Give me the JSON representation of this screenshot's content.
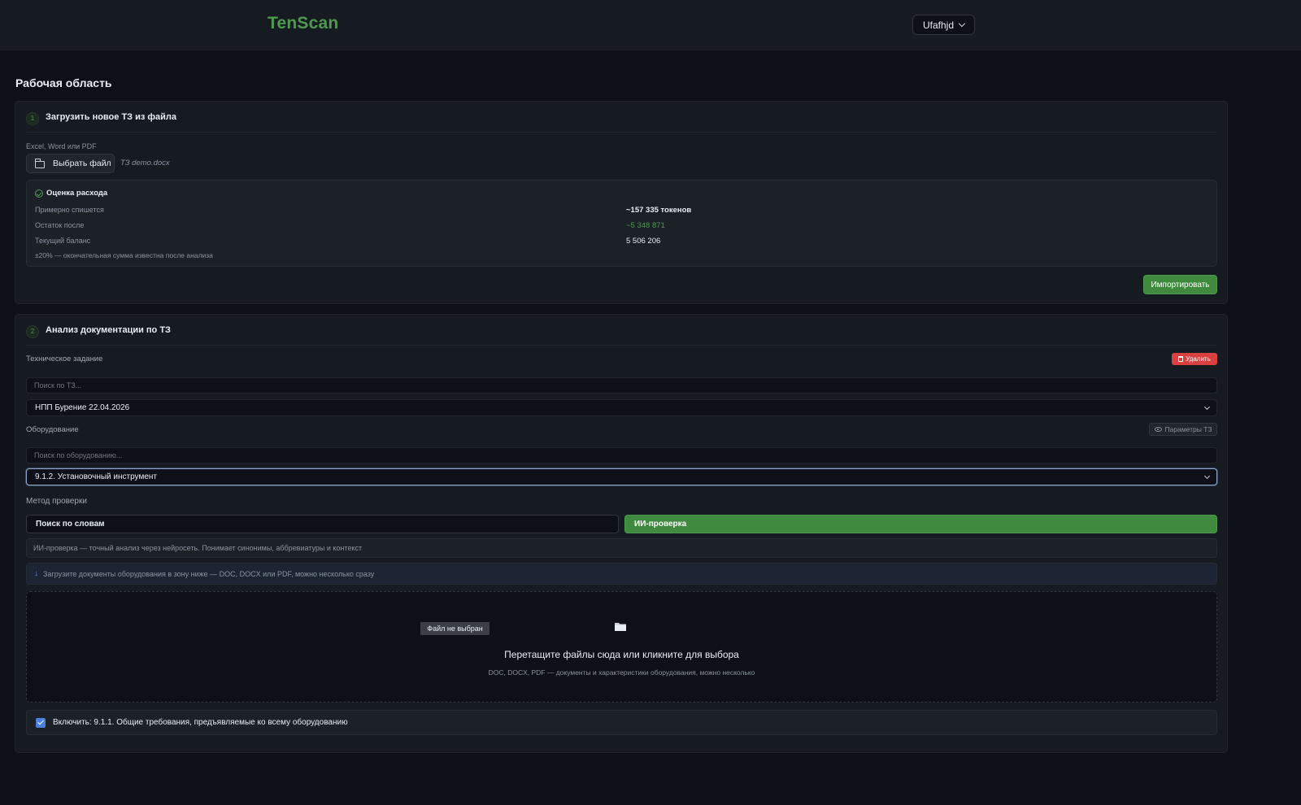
{
  "header": {
    "logo": "TenScan",
    "user_name": "Ufafhjd"
  },
  "page_title": "Рабочая область",
  "import_section": {
    "step": "1",
    "title": "Загрузить новое ТЗ из файла",
    "formats_hint": "Excel, Word или PDF",
    "choose_file_label": "Выбрать файл",
    "file_name": "ТЗ demo.docx",
    "estimate": {
      "title": "Оценка расхода",
      "rows": [
        {
          "label": "Примерно спишется",
          "value": "~157 335 токенов"
        },
        {
          "label": "Остаток после",
          "value": "~5 348 871"
        },
        {
          "label": "Текущий баланс",
          "value": "5 506 206"
        }
      ],
      "note": "±20% — окончательная сумма известна после анализа"
    },
    "import_button": "Импортировать"
  },
  "analysis_section": {
    "step": "2",
    "title": "Анализ документации по ТЗ",
    "tz_label": "Техническое задание",
    "delete_button": "Удалить",
    "tz_search_placeholder": "Поиск по ТЗ...",
    "tz_selected": "НПП Бурение 22.04.2026",
    "equipment_label": "Оборудование",
    "params_button": "Параметры ТЗ",
    "equipment_search_placeholder": "Поиск по оборудованию...",
    "equipment_selected": "9.1.2. Установочный инструмент",
    "method_label": "Метод проверки",
    "method_words": "Поиск по словам",
    "method_ai": "ИИ-проверка",
    "method_description": "ИИ-проверка — точный анализ через нейросеть. Понимает синонимы, аббревиатуры и контекст",
    "upload_hint": "Загрузите документы оборудования в зону ниже — DOC, DOCX или PDF, можно несколько сразу",
    "dropzone": {
      "no_file": "Файл не выбран",
      "title": "Перетащите файлы сюда или кликните для выбора",
      "subtitle": "DOC, DOCX, PDF — документы и характеристики оборудования, можно несколько"
    },
    "include_label": "Включить: 9.1.1. Общие требования, предъявляемые ко всему оборудованию",
    "include_checked": true
  },
  "colors": {
    "accent_green": "#4e9a4e",
    "danger_red": "#d94141",
    "background": "#0d1117",
    "card": "#161b22"
  }
}
